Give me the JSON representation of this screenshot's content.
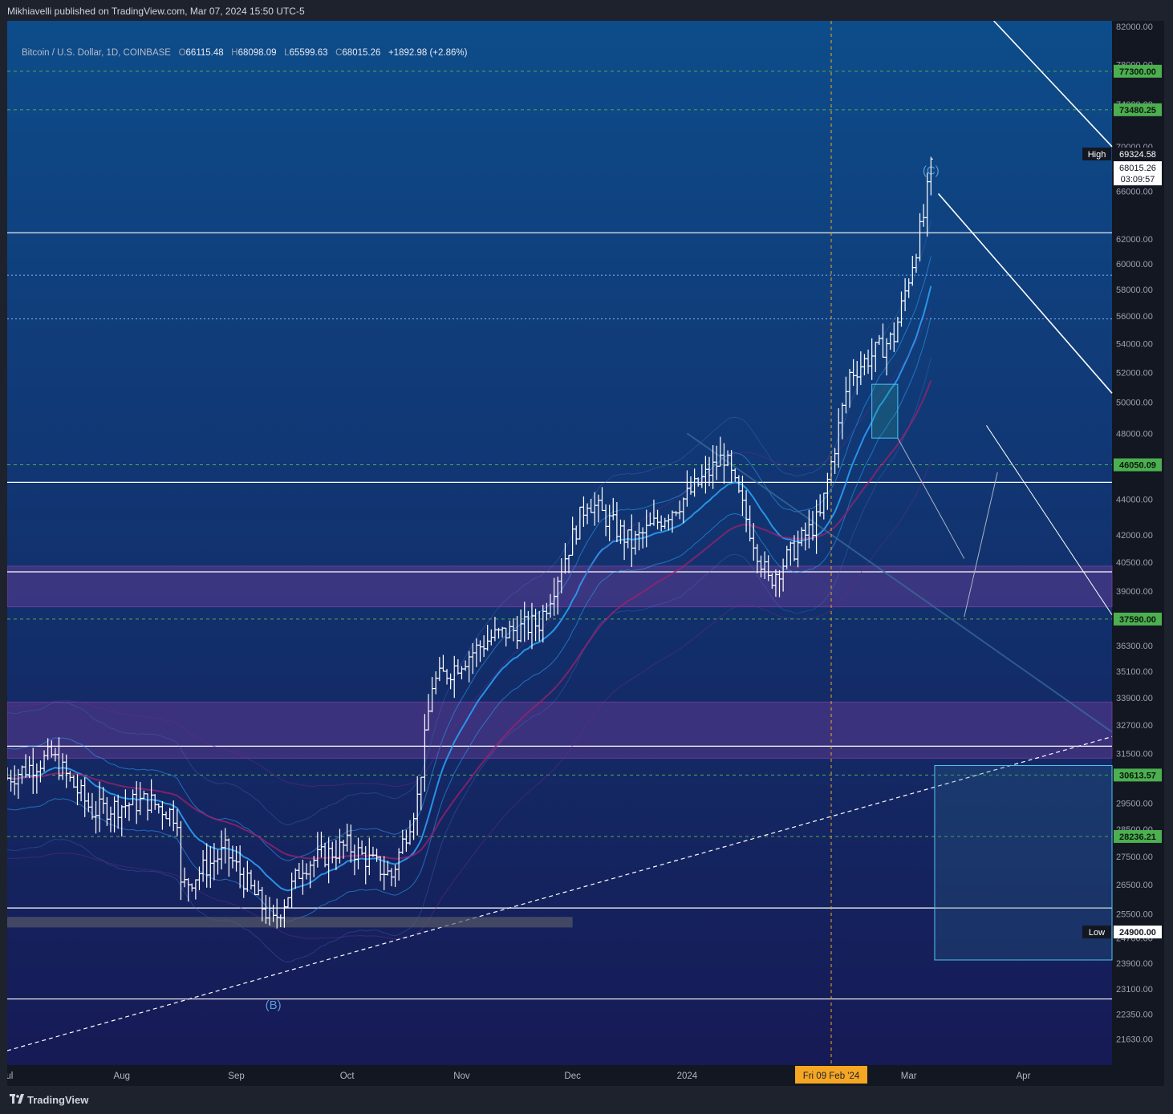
{
  "header": {
    "published_text": "Mikhiavelli published on TradingView.com, Mar 07, 2024 15:50 UTC-5"
  },
  "legend": {
    "symbol": "Bitcoin / U.S. Dollar, 1D, COINBASE",
    "o_label": "O",
    "o_value": "66115.48",
    "h_label": "H",
    "h_value": "68098.09",
    "l_label": "L",
    "l_value": "65599.63",
    "c_label": "C",
    "c_value": "68015.26",
    "change": "+1892.98 (+2.86%)"
  },
  "footer": {
    "brand": "TradingView"
  },
  "colors": {
    "bg_top": "#0d4c8a",
    "bg_bottom": "#161a55",
    "level_green": "#4caf50",
    "band_purple": "#7b3fa0",
    "ma_blue": "#2a9df4",
    "ma_magenta": "#a0206e",
    "crosshair": "#f5a623",
    "wave_label": "#5b9bd5"
  },
  "chart_data": {
    "type": "ohlc",
    "log_scale": true,
    "ylim": [
      20900,
      82600
    ],
    "x_ticks": [
      {
        "label": "Jul",
        "date": "2023-07-01"
      },
      {
        "label": "Aug",
        "date": "2023-08-01"
      },
      {
        "label": "Sep",
        "date": "2023-09-01"
      },
      {
        "label": "Oct",
        "date": "2023-10-01"
      },
      {
        "label": "Nov",
        "date": "2023-11-01"
      },
      {
        "label": "Dec",
        "date": "2023-12-01"
      },
      {
        "label": "2024",
        "date": "2024-01-01"
      },
      {
        "label": "Mar",
        "date": "2024-03-01"
      },
      {
        "label": "Apr",
        "date": "2024-04-01"
      }
    ],
    "y_ticks": [
      "82000.00",
      "78000.00",
      "74000.00",
      "70000.00",
      "66000.00",
      "62000.00",
      "60000.00",
      "58000.00",
      "56000.00",
      "54000.00",
      "52000.00",
      "50000.00",
      "48000.00",
      "44000.00",
      "42000.00",
      "40500.00",
      "39000.00",
      "36300.00",
      "35100.00",
      "33900.00",
      "32700.00",
      "31500.00",
      "29500.00",
      "28500.00",
      "27500.00",
      "26500.00",
      "25500.00",
      "24700.00",
      "23900.00",
      "23100.00",
      "22350.00",
      "21630.00"
    ],
    "horizontal_levels": [
      {
        "price": 77300,
        "label": "77300.00",
        "style": "green-dashed"
      },
      {
        "price": 73480.25,
        "label": "73480.25",
        "style": "green-dashed"
      },
      {
        "price": 46050.09,
        "label": "46050.09",
        "style": "green-dashed"
      },
      {
        "price": 37590.0,
        "label": "37590.00",
        "style": "green-dashed"
      },
      {
        "price": 30613.57,
        "label": "30613.57",
        "style": "green-dashed"
      },
      {
        "price": 28236.21,
        "label": "28236.21",
        "style": "green-dashed"
      },
      {
        "price": 62500,
        "label": "",
        "style": "white-solid"
      },
      {
        "price": 45000,
        "label": "",
        "style": "white-solid"
      },
      {
        "price": 40000,
        "label": "",
        "style": "white-solid"
      },
      {
        "price": 31800,
        "label": "",
        "style": "white-solid"
      },
      {
        "price": 25700,
        "label": "",
        "style": "white-solid"
      },
      {
        "price": 22800,
        "label": "",
        "style": "white-solid"
      },
      {
        "price": 59100,
        "label": "",
        "style": "blue-dotted"
      },
      {
        "price": 55800,
        "label": "",
        "style": "blue-dotted"
      }
    ],
    "price_tags": {
      "high_label": "High",
      "high_value": "69324.58",
      "last_value": "68015.26",
      "countdown": "03:09:57",
      "low_label": "Low",
      "low_value": "24900.00"
    },
    "zones": [
      {
        "from": 38200,
        "to": 40300,
        "color": "#7b3fa0"
      },
      {
        "from": 31300,
        "to": 33700,
        "color": "#7b3fa0"
      }
    ],
    "crosshair_x_label": "Fri 09 Feb '24",
    "wave_labels": [
      {
        "text": "(B)",
        "date": "2023-09-11",
        "price": 22500
      },
      {
        "text": "(C)",
        "date": "2024-03-07",
        "price": 67500
      }
    ],
    "price_path": [
      {
        "date": "2023-07-01",
        "close": 30500
      },
      {
        "date": "2023-07-13",
        "close": 31400
      },
      {
        "date": "2023-07-24",
        "close": 29200
      },
      {
        "date": "2023-08-08",
        "close": 29600
      },
      {
        "date": "2023-08-16",
        "close": 29000
      },
      {
        "date": "2023-08-17",
        "close": 26400
      },
      {
        "date": "2023-08-29",
        "close": 27700
      },
      {
        "date": "2023-09-11",
        "close": 25200
      },
      {
        "date": "2023-09-19",
        "close": 27200
      },
      {
        "date": "2023-10-01",
        "close": 27900
      },
      {
        "date": "2023-10-13",
        "close": 26800
      },
      {
        "date": "2023-10-20",
        "close": 29700
      },
      {
        "date": "2023-10-24",
        "close": 34500
      },
      {
        "date": "2023-11-09",
        "close": 36700
      },
      {
        "date": "2023-11-22",
        "close": 37400
      },
      {
        "date": "2023-12-05",
        "close": 44000
      },
      {
        "date": "2023-12-17",
        "close": 41500
      },
      {
        "date": "2024-01-01",
        "close": 44200
      },
      {
        "date": "2024-01-11",
        "close": 46600
      },
      {
        "date": "2024-01-23",
        "close": 39500
      },
      {
        "date": "2024-02-06",
        "close": 43000
      },
      {
        "date": "2024-02-14",
        "close": 51900
      },
      {
        "date": "2024-02-26",
        "close": 54500
      },
      {
        "date": "2024-03-05",
        "close": 63800
      },
      {
        "date": "2024-03-07",
        "close": 68015.26
      }
    ]
  }
}
